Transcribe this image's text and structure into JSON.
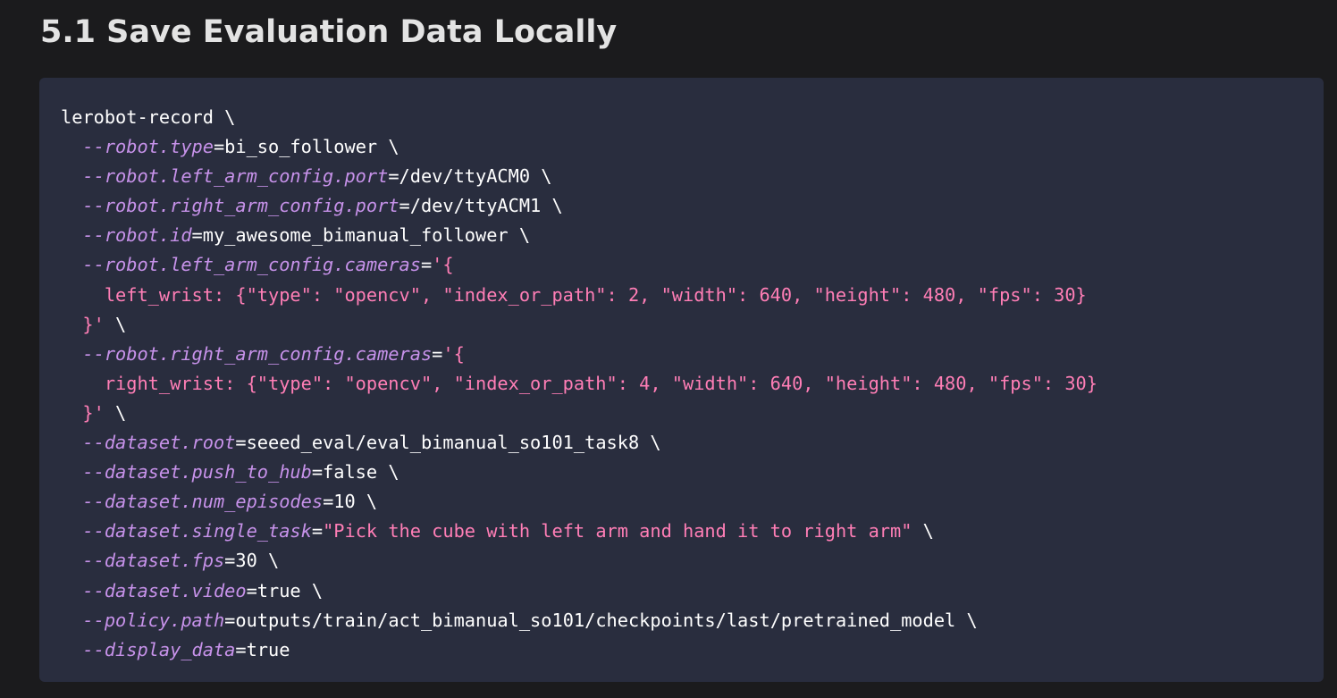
{
  "section_heading": "5.1 Save Evaluation Data Locally",
  "colors": {
    "page_background": "#1b1b1d",
    "code_background": "#292d3e",
    "heading_text": "#e3e3e3",
    "plain_text": "#ffffff",
    "option_text": "#c792ea",
    "string_text": "#ff7eb6"
  },
  "code_lines": [
    [
      {
        "t": "lerobot-record \\",
        "k": "plain"
      }
    ],
    [
      {
        "t": "  ",
        "k": "plain"
      },
      {
        "t": "--robot.type",
        "k": "opt"
      },
      {
        "t": "=bi_so_follower \\",
        "k": "plain"
      }
    ],
    [
      {
        "t": "  ",
        "k": "plain"
      },
      {
        "t": "--robot.left_arm_config.port",
        "k": "opt"
      },
      {
        "t": "=/dev/ttyACM0 \\",
        "k": "plain"
      }
    ],
    [
      {
        "t": "  ",
        "k": "plain"
      },
      {
        "t": "--robot.right_arm_config.port",
        "k": "opt"
      },
      {
        "t": "=/dev/ttyACM1 \\",
        "k": "plain"
      }
    ],
    [
      {
        "t": "  ",
        "k": "plain"
      },
      {
        "t": "--robot.id",
        "k": "opt"
      },
      {
        "t": "=my_awesome_bimanual_follower \\",
        "k": "plain"
      }
    ],
    [
      {
        "t": "  ",
        "k": "plain"
      },
      {
        "t": "--robot.left_arm_config.cameras",
        "k": "opt"
      },
      {
        "t": "=",
        "k": "plain"
      },
      {
        "t": "'{",
        "k": "str"
      }
    ],
    [
      {
        "t": "    left_wrist: {\"type\": \"opencv\", \"index_or_path\": 2, \"width\": 640, \"height\": 480, \"fps\": 30}",
        "k": "str"
      }
    ],
    [
      {
        "t": "  ",
        "k": "plain"
      },
      {
        "t": "}'",
        "k": "str"
      },
      {
        "t": " \\",
        "k": "plain"
      }
    ],
    [
      {
        "t": "  ",
        "k": "plain"
      },
      {
        "t": "--robot.right_arm_config.cameras",
        "k": "opt"
      },
      {
        "t": "=",
        "k": "plain"
      },
      {
        "t": "'{",
        "k": "str"
      }
    ],
    [
      {
        "t": "    right_wrist: {\"type\": \"opencv\", \"index_or_path\": 4, \"width\": 640, \"height\": 480, \"fps\": 30}",
        "k": "str"
      }
    ],
    [
      {
        "t": "  ",
        "k": "plain"
      },
      {
        "t": "}'",
        "k": "str"
      },
      {
        "t": " \\",
        "k": "plain"
      }
    ],
    [
      {
        "t": "  ",
        "k": "plain"
      },
      {
        "t": "--dataset.root",
        "k": "opt"
      },
      {
        "t": "=seeed_eval/eval_bimanual_so101_task8 \\",
        "k": "plain"
      }
    ],
    [
      {
        "t": "  ",
        "k": "plain"
      },
      {
        "t": "--dataset.push_to_hub",
        "k": "opt"
      },
      {
        "t": "=false \\",
        "k": "plain"
      }
    ],
    [
      {
        "t": "  ",
        "k": "plain"
      },
      {
        "t": "--dataset.num_episodes",
        "k": "opt"
      },
      {
        "t": "=10 \\",
        "k": "plain"
      }
    ],
    [
      {
        "t": "  ",
        "k": "plain"
      },
      {
        "t": "--dataset.single_task",
        "k": "opt"
      },
      {
        "t": "=",
        "k": "plain"
      },
      {
        "t": "\"Pick the cube with left arm and hand it to right arm\"",
        "k": "str"
      },
      {
        "t": " \\",
        "k": "plain"
      }
    ],
    [
      {
        "t": "  ",
        "k": "plain"
      },
      {
        "t": "--dataset.fps",
        "k": "opt"
      },
      {
        "t": "=30 \\",
        "k": "plain"
      }
    ],
    [
      {
        "t": "  ",
        "k": "plain"
      },
      {
        "t": "--dataset.video",
        "k": "opt"
      },
      {
        "t": "=true \\",
        "k": "plain"
      }
    ],
    [
      {
        "t": "  ",
        "k": "plain"
      },
      {
        "t": "--policy.path",
        "k": "opt"
      },
      {
        "t": "=outputs/train/act_bimanual_so101/checkpoints/last/pretrained_model \\",
        "k": "plain"
      }
    ],
    [
      {
        "t": "  ",
        "k": "plain"
      },
      {
        "t": "--display_data",
        "k": "opt"
      },
      {
        "t": "=true",
        "k": "plain"
      }
    ]
  ]
}
